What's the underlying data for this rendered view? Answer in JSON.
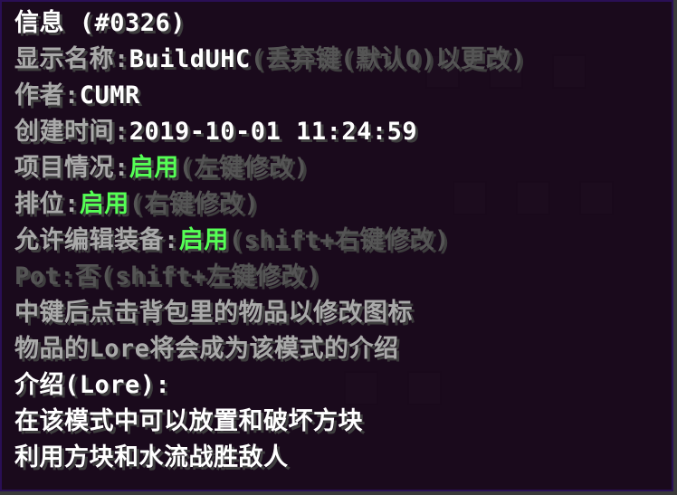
{
  "tooltip": {
    "title": "信息 (#0326)",
    "display_name": {
      "label": "显示名称:",
      "value": "BuildUHC",
      "hint": "(丢弃键(默认Q)以更改)"
    },
    "author": {
      "label": "作者:",
      "value": "CUMR"
    },
    "created": {
      "label": "创建时间:",
      "value": "2019-10-01 11:24:59"
    },
    "project_status": {
      "label": "项目情况:",
      "value": "启用",
      "hint": "(左键修改)"
    },
    "ranking": {
      "label": "排位:",
      "value": "启用",
      "hint": "(右键修改)"
    },
    "allow_edit_gear": {
      "label": "允许编辑装备:",
      "value": "启用",
      "hint": "(shift+右键修改)"
    },
    "pot": {
      "label": "Pot:",
      "value": "否",
      "hint": "(shift+左键修改)"
    },
    "info_line_1": "中键后点击背包里的物品以修改图标",
    "info_line_2": "物品的Lore将会成为该模式的介绍",
    "lore_header": "介绍(Lore):",
    "lore_line_1": "在该模式中可以放置和破坏方块",
    "lore_line_2": "利用方块和水流战胜敌人"
  },
  "colors": {
    "background": "#18061a",
    "border": "#2a0f55",
    "enabled": "#55ff55",
    "label": "#aaaaaa",
    "hint": "#555555",
    "value": "#ffffff"
  }
}
